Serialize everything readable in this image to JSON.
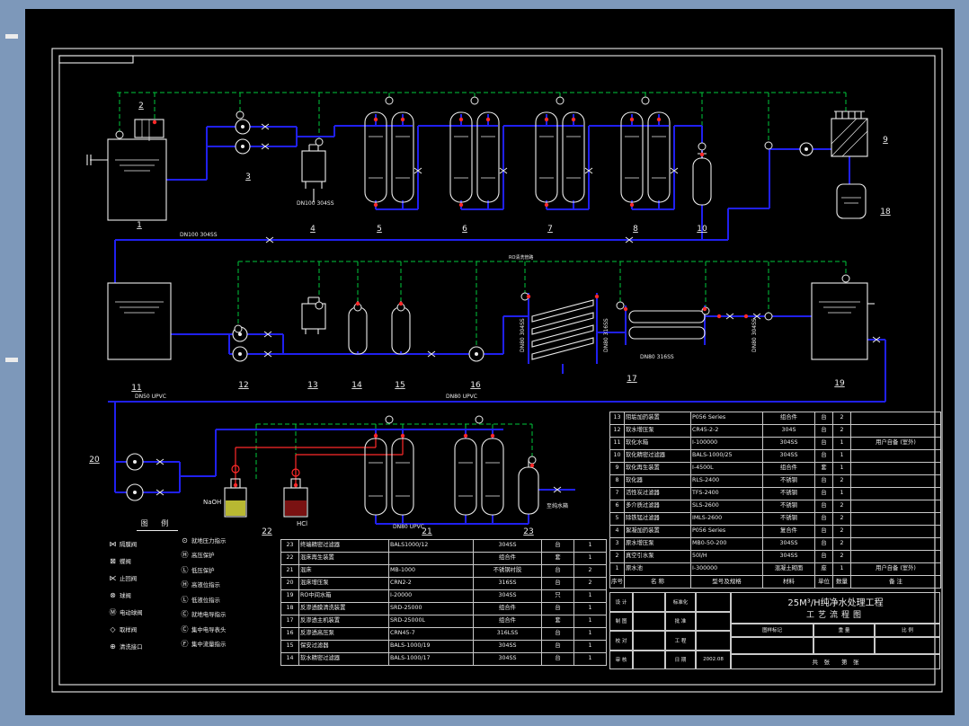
{
  "colors": {
    "frame": "#7d98ba",
    "canvas": "#000000",
    "pipe": "#2020f0",
    "control_signal": "#00c93c",
    "alarm": "#ff2a2a",
    "linework": "#ececec"
  },
  "diagram": {
    "numbers": [
      "1",
      "2",
      "3",
      "4",
      "5",
      "6",
      "7",
      "8",
      "9",
      "10",
      "11",
      "12",
      "13",
      "14",
      "15",
      "16",
      "17",
      "18",
      "19",
      "20",
      "21",
      "22",
      "23"
    ],
    "labels": {
      "dn100_main": "DN100 304SS",
      "dn100_2": "DN100 304SS",
      "dn50_upvc": "DN50 UPVC",
      "dn80_upvc": "DN80 UPVC",
      "dn80_upvc2": "DN80 UPVC",
      "dn80_304_a": "DN80 304SS",
      "dn80_316_a": "DN80 316SS",
      "dn80_316_b": "DN80 316SS",
      "dn80_304_b": "DN80 304SS",
      "ro_clean": "RO清洗管路",
      "to_pure_tank": "至纯水箱",
      "naoh": "NaOH",
      "hcl": "HCl"
    }
  },
  "legend": {
    "title": "图 例",
    "left": [
      {
        "icon": "diaphragm-valve-icon",
        "glyph": "⋈",
        "label": "隔膜阀"
      },
      {
        "icon": "butterfly-valve-icon",
        "glyph": "⊠",
        "label": "蝶阀"
      },
      {
        "icon": "check-valve-icon",
        "glyph": "⋉",
        "label": "止回阀"
      },
      {
        "icon": "ball-valve-icon",
        "glyph": "⊗",
        "label": "球阀"
      },
      {
        "icon": "motor-ball-valve-icon",
        "glyph": "Ⓜ",
        "label": "电动球阀"
      },
      {
        "icon": "sample-valve-icon",
        "glyph": "◇",
        "label": "取样阀"
      },
      {
        "icon": "flush-port-icon",
        "glyph": "⊕",
        "label": "清洗接口"
      }
    ],
    "right": [
      {
        "icon": "pressure-gauge-icon",
        "glyph": "⊙",
        "label": "就地压力指示"
      },
      {
        "icon": "high-pressure-switch-icon",
        "glyph": "Ⓗ",
        "label": "高压保护"
      },
      {
        "icon": "low-pressure-switch-icon",
        "glyph": "Ⓛ",
        "label": "低压保护"
      },
      {
        "icon": "high-level-icon",
        "glyph": "Ⓗ",
        "label": "高液位指示"
      },
      {
        "icon": "low-level-icon",
        "glyph": "Ⓛ",
        "label": "低液位指示"
      },
      {
        "icon": "conductivity-local-icon",
        "glyph": "Ⓒ",
        "label": "就地电导指示"
      },
      {
        "icon": "conductivity-central-icon",
        "glyph": "Ⓒ",
        "label": "集中电导表头"
      },
      {
        "icon": "flow-central-icon",
        "glyph": "Ⓕ",
        "label": "集中流量指示"
      }
    ]
  },
  "bom_right": {
    "headers": [
      "序号",
      "名  称",
      "型号及规格",
      "材料",
      "单位",
      "数量",
      "备  注"
    ],
    "rows": [
      {
        "seq": "13",
        "name": "阻垢加药装置",
        "model": "P056 Series",
        "material": "组合件",
        "unit": "台",
        "qty": "2",
        "note": ""
      },
      {
        "seq": "12",
        "name": "软水增压泵",
        "model": "CR45-2-2",
        "material": "304S",
        "unit": "台",
        "qty": "2",
        "note": ""
      },
      {
        "seq": "11",
        "name": "软化水箱",
        "model": "I-100000",
        "material": "304SS",
        "unit": "台",
        "qty": "1",
        "note": "用户自备 (室外)"
      },
      {
        "seq": "10",
        "name": "软化精密过滤器",
        "model": "BALS-1000/25",
        "material": "304SS",
        "unit": "台",
        "qty": "1",
        "note": ""
      },
      {
        "seq": "9",
        "name": "软化再生装置",
        "model": "I-4500L",
        "material": "组合件",
        "unit": "套",
        "qty": "1",
        "note": ""
      },
      {
        "seq": "8",
        "name": "软化器",
        "model": "RLS-2400",
        "material": "不锈钢",
        "unit": "台",
        "qty": "2",
        "note": ""
      },
      {
        "seq": "7",
        "name": "活性炭过滤器",
        "model": "TFS-2400",
        "material": "不锈钢",
        "unit": "台",
        "qty": "1",
        "note": ""
      },
      {
        "seq": "6",
        "name": "多介质过滤器",
        "model": "SLS-2600",
        "material": "不锈钢",
        "unit": "台",
        "qty": "2",
        "note": ""
      },
      {
        "seq": "5",
        "name": "除铁锰过滤器",
        "model": "IMLS-2600",
        "material": "不锈钢",
        "unit": "台",
        "qty": "2",
        "note": ""
      },
      {
        "seq": "4",
        "name": "絮凝加药装置",
        "model": "P056 Series",
        "material": "复合件",
        "unit": "台",
        "qty": "2",
        "note": ""
      },
      {
        "seq": "3",
        "name": "原水增压泵",
        "model": "MB0-50-200",
        "material": "304SS",
        "unit": "台",
        "qty": "2",
        "note": ""
      },
      {
        "seq": "2",
        "name": "真空引水泵",
        "model": "50l/H",
        "material": "304SS",
        "unit": "台",
        "qty": "2",
        "note": ""
      },
      {
        "seq": "1",
        "name": "原水池",
        "model": "I-300000",
        "material": "混凝土砌面",
        "unit": "座",
        "qty": "1",
        "note": "用户自备 (室外)"
      }
    ]
  },
  "bom_left": {
    "rows": [
      {
        "seq": "23",
        "name": "终端精密过滤器",
        "model": "BALS1000/12",
        "material": "304SS",
        "unit": "台",
        "qty": "1"
      },
      {
        "seq": "22",
        "name": "混床再生装置",
        "model": "",
        "material": "组合件",
        "unit": "套",
        "qty": "1"
      },
      {
        "seq": "21",
        "name": "混床",
        "model": "MB-1000",
        "material": "不锈钢衬胶",
        "unit": "台",
        "qty": "2"
      },
      {
        "seq": "20",
        "name": "混床增压泵",
        "model": "CRN2-2",
        "material": "316SS",
        "unit": "台",
        "qty": "2"
      },
      {
        "seq": "19",
        "name": "RO中间水箱",
        "model": "I-20000",
        "material": "304SS",
        "unit": "只",
        "qty": "1"
      },
      {
        "seq": "18",
        "name": "反渗透膜清洗装置",
        "model": "SRD-25000",
        "material": "组合件",
        "unit": "台",
        "qty": "1"
      },
      {
        "seq": "17",
        "name": "反渗透主机装置",
        "model": "SRD-25000L",
        "material": "组合件",
        "unit": "套",
        "qty": "1"
      },
      {
        "seq": "16",
        "name": "反渗透高压泵",
        "model": "CRN45-7",
        "material": "316LSS",
        "unit": "台",
        "qty": "1"
      },
      {
        "seq": "15",
        "name": "保安过滤器",
        "model": "BALS-1000/19",
        "material": "304SS",
        "unit": "台",
        "qty": "1"
      },
      {
        "seq": "14",
        "name": "软水精密过滤器",
        "model": "BALS-1000/17",
        "material": "304SS",
        "unit": "台",
        "qty": "1"
      }
    ]
  },
  "title_block": {
    "project_line1": "25M³/H纯净水处理工程",
    "project_line2": "工艺流程图",
    "rows": [
      {
        "a": "设 计",
        "b": "",
        "c": "标准化",
        "d": ""
      },
      {
        "a": "制 图",
        "b": "",
        "c": "批 准",
        "d": ""
      },
      {
        "a": "校 对",
        "b": "",
        "c": "工 程",
        "d": ""
      },
      {
        "a": "审 核",
        "b": "",
        "c": "日 期",
        "d": "2002.08"
      }
    ],
    "marks": [
      "图样标记",
      "重  量",
      "比  例"
    ],
    "sheets": "共　张　　第　张"
  }
}
